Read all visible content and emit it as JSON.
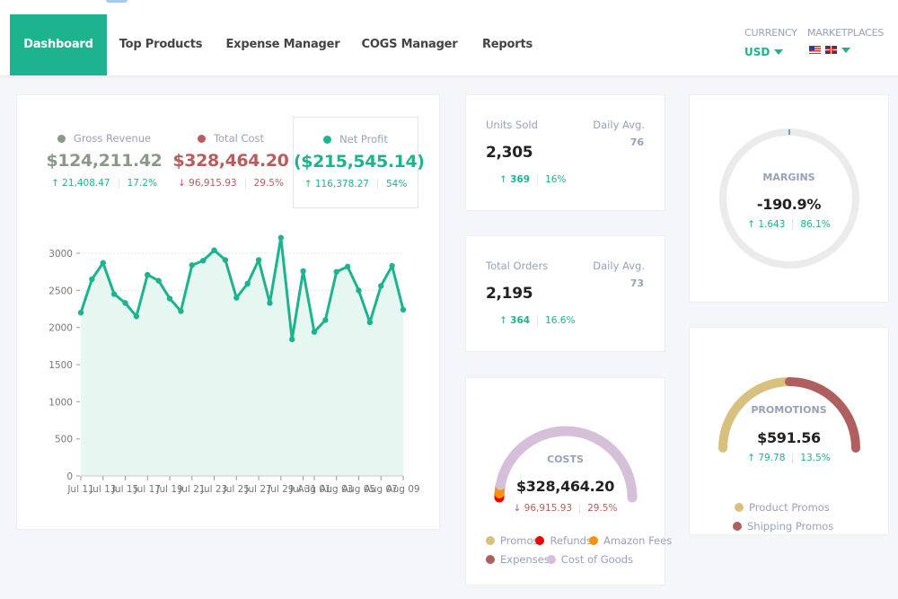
{
  "nav": {
    "tabs": [
      {
        "label": "Dashboard",
        "active": true
      },
      {
        "label": "Top Products",
        "active": false
      },
      {
        "label": "Expense Manager",
        "active": false
      },
      {
        "label": "COGS Manager",
        "active": false
      },
      {
        "label": "Reports",
        "active": false
      }
    ],
    "currency": {
      "label": "CURRENCY",
      "value": "USD"
    },
    "marketplaces": {
      "label": "MARKETPLACES",
      "flags": [
        "us-flag",
        "uk-flag"
      ]
    }
  },
  "colors": {
    "accent": "#1eb38f",
    "gross_revenue": "#8b9a88",
    "total_cost": "#b85d5d",
    "net_profit": "#1eb38f",
    "promos": "#d8c07e",
    "refunds": "#ee0000",
    "amazon_fees": "#f5930c",
    "expenses": "#b05f5f",
    "cost_of_goods": "#d6bfd9",
    "product_promos": "#d8c07e",
    "shipping_promos": "#b05f5f"
  },
  "summary": {
    "gross_revenue": {
      "label": "Gross Revenue",
      "value": "$124,211.42",
      "delta": "21,408.47",
      "delta_dir": "up",
      "pct": "17.2%"
    },
    "total_cost": {
      "label": "Total Cost",
      "value": "$328,464.20",
      "delta": "96,915.93",
      "delta_dir": "down",
      "pct": "29.5%"
    },
    "net_profit": {
      "label": "Net Profit",
      "value": "($215,545.14)",
      "delta": "116,378.27",
      "delta_dir": "up",
      "pct": "54%"
    }
  },
  "chart_data": {
    "type": "area",
    "title": "",
    "xlabel": "",
    "ylabel": "",
    "ylim": [
      0,
      3000
    ],
    "yticks": [
      0,
      500,
      1000,
      1500,
      2000,
      2500,
      3000
    ],
    "grid": true,
    "x": [
      "Jul 11",
      "Jul 12",
      "Jul 13",
      "Jul 14",
      "Jul 15",
      "Jul 16",
      "Jul 17",
      "Jul 18",
      "Jul 19",
      "Jul 20",
      "Jul 21",
      "Jul 22",
      "Jul 23",
      "Jul 24",
      "Jul 25",
      "Jul 26",
      "Jul 27",
      "Jul 28",
      "Jul 29",
      "Jul 30",
      "Jul 31",
      "Aug 01",
      "Aug 02",
      "Aug 03",
      "Aug 04",
      "Aug 05",
      "Aug 06",
      "Aug 07",
      "Aug 08",
      "Aug 09"
    ],
    "xtick_labels": [
      "Jul 11",
      "Jul 13",
      "Jul 15",
      "Jul 17",
      "Jul 19",
      "Jul 21",
      "Jul 23",
      "Jul 25",
      "Jul 27",
      "Jul 29",
      "Jul 31",
      "Aug 01",
      "Aug 03",
      "Aug 05",
      "Aug 07",
      "Aug 09"
    ],
    "series": [
      {
        "name": "Net Profit",
        "values": [
          2200,
          2650,
          2870,
          2450,
          2330,
          2150,
          2710,
          2630,
          2390,
          2220,
          2840,
          2900,
          3040,
          2910,
          2400,
          2590,
          2910,
          2330,
          3210,
          1840,
          2760,
          1940,
          2100,
          2750,
          2820,
          2500,
          2070,
          2560,
          2830,
          2240
        ]
      }
    ]
  },
  "units_sold": {
    "label": "Units Sold",
    "value": "2,305",
    "avg_label": "Daily Avg.",
    "avg_value": "76",
    "delta": "369",
    "delta_dir": "up",
    "pct": "16%"
  },
  "total_orders": {
    "label": "Total Orders",
    "value": "2,195",
    "avg_label": "Daily Avg.",
    "avg_value": "73",
    "delta": "364",
    "delta_dir": "up",
    "pct": "16.6%"
  },
  "costs": {
    "title": "COSTS",
    "value": "$328,464.20",
    "delta": "96,915.93",
    "delta_dir": "down",
    "pct": "29.5%",
    "segments_fraction": {
      "refunds": 0.02,
      "amazon_fees": 0.04,
      "promos": 0.0,
      "expenses": 0.0,
      "cost_of_goods": 0.94
    },
    "legend": [
      {
        "label": "Promos",
        "color_key": "promos"
      },
      {
        "label": "Refunds",
        "color_key": "refunds"
      },
      {
        "label": "Amazon Fees",
        "color_key": "amazon_fees"
      },
      {
        "label": "Expenses",
        "color_key": "expenses"
      },
      {
        "label": "Cost of Goods",
        "color_key": "cost_of_goods"
      }
    ]
  },
  "margins": {
    "title": "MARGINS",
    "value": "-190.9%",
    "delta": "1.643",
    "delta_dir": "up",
    "pct": "86.1%"
  },
  "promotions": {
    "title": "PROMOTIONS",
    "value": "$591.56",
    "delta": "79.78",
    "delta_dir": "up",
    "pct": "13.5%",
    "segments_fraction": {
      "product_promos": 0.5,
      "shipping_promos": 0.5
    },
    "legend": [
      {
        "label": "Product Promos",
        "color_key": "product_promos"
      },
      {
        "label": "Shipping Promos",
        "color_key": "shipping_promos"
      }
    ]
  }
}
